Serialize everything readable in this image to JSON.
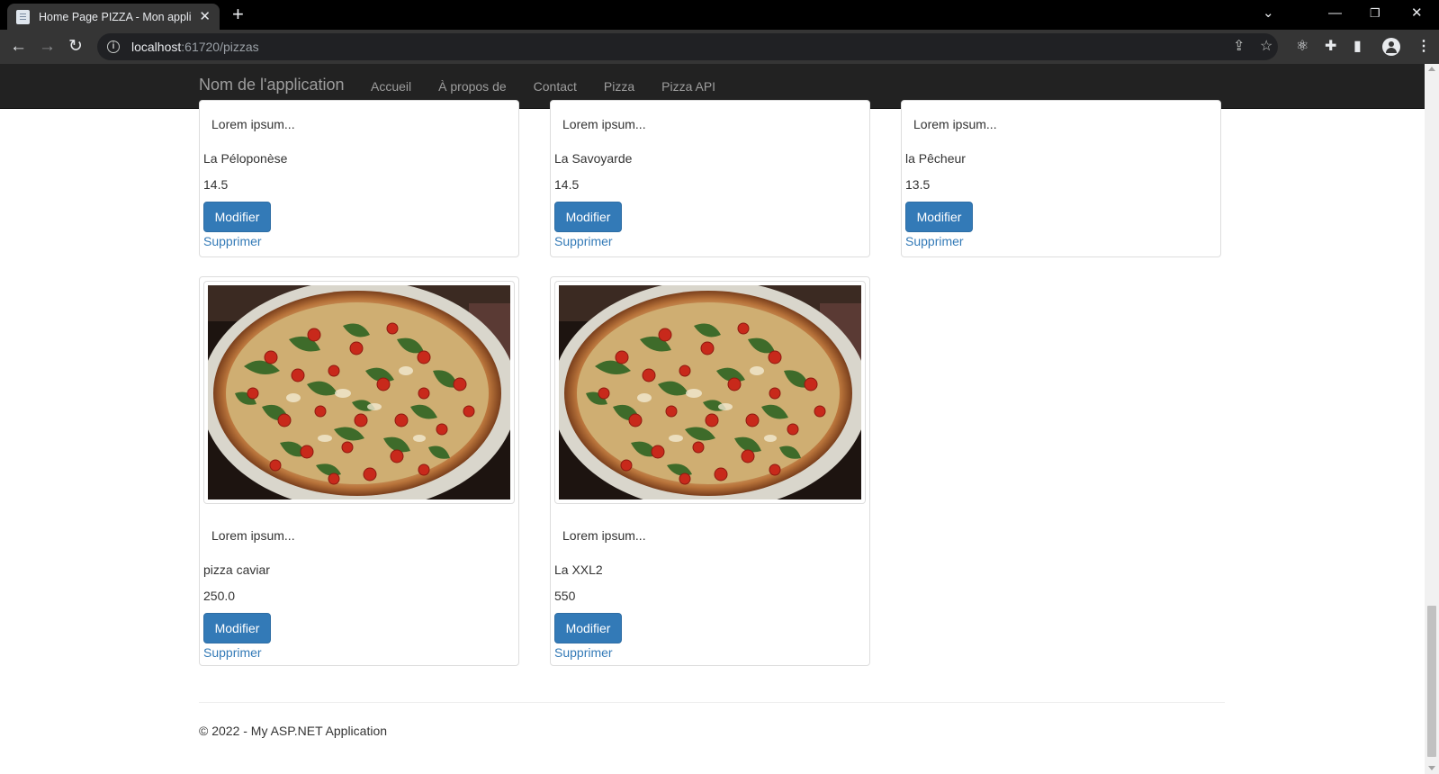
{
  "browser": {
    "tab_title": "Home Page PIZZA - Mon application ASP.NET",
    "new_tab": "+",
    "url_host": "localhost",
    "url_path": ":61720/pizzas"
  },
  "site": {
    "brand": "Nom de l'application",
    "nav": [
      "Accueil",
      "À propos de",
      "Contact",
      "Pizza",
      "Pizza API"
    ]
  },
  "pizzas": [
    {
      "desc": "Lorem ipsum...",
      "name": "La Péloponèse",
      "price": "14.5",
      "edit_label": "Modifier",
      "delete_label": "Supprimer",
      "has_image_visible": false
    },
    {
      "desc": "Lorem ipsum...",
      "name": "La Savoyarde",
      "price": "14.5",
      "edit_label": "Modifier",
      "delete_label": "Supprimer",
      "has_image_visible": false
    },
    {
      "desc": "Lorem ipsum...",
      "name": "la Pêcheur",
      "price": "13.5",
      "edit_label": "Modifier",
      "delete_label": "Supprimer",
      "has_image_visible": false
    },
    {
      "desc": "Lorem ipsum...",
      "name": "pizza caviar",
      "price": "250.0",
      "edit_label": "Modifier",
      "delete_label": "Supprimer",
      "has_image_visible": true
    },
    {
      "desc": "Lorem ipsum...",
      "name": "La XXL2",
      "price": "550",
      "edit_label": "Modifier",
      "delete_label": "Supprimer",
      "has_image_visible": true
    }
  ],
  "footer": "© 2022 - My ASP.NET Application",
  "colors": {
    "navbar_bg": "#222222",
    "nav_text": "#9d9d9d",
    "button_primary": "#337ab7",
    "link": "#337ab7"
  },
  "icons": [
    "back-icon",
    "forward-icon",
    "reload-icon",
    "info-icon",
    "share-icon",
    "star-icon",
    "react-devtools-icon",
    "extensions-icon",
    "side-panel-icon",
    "profile-icon",
    "menu-icon",
    "tab-list-icon",
    "minimize-icon",
    "restore-icon",
    "close-window-icon"
  ]
}
